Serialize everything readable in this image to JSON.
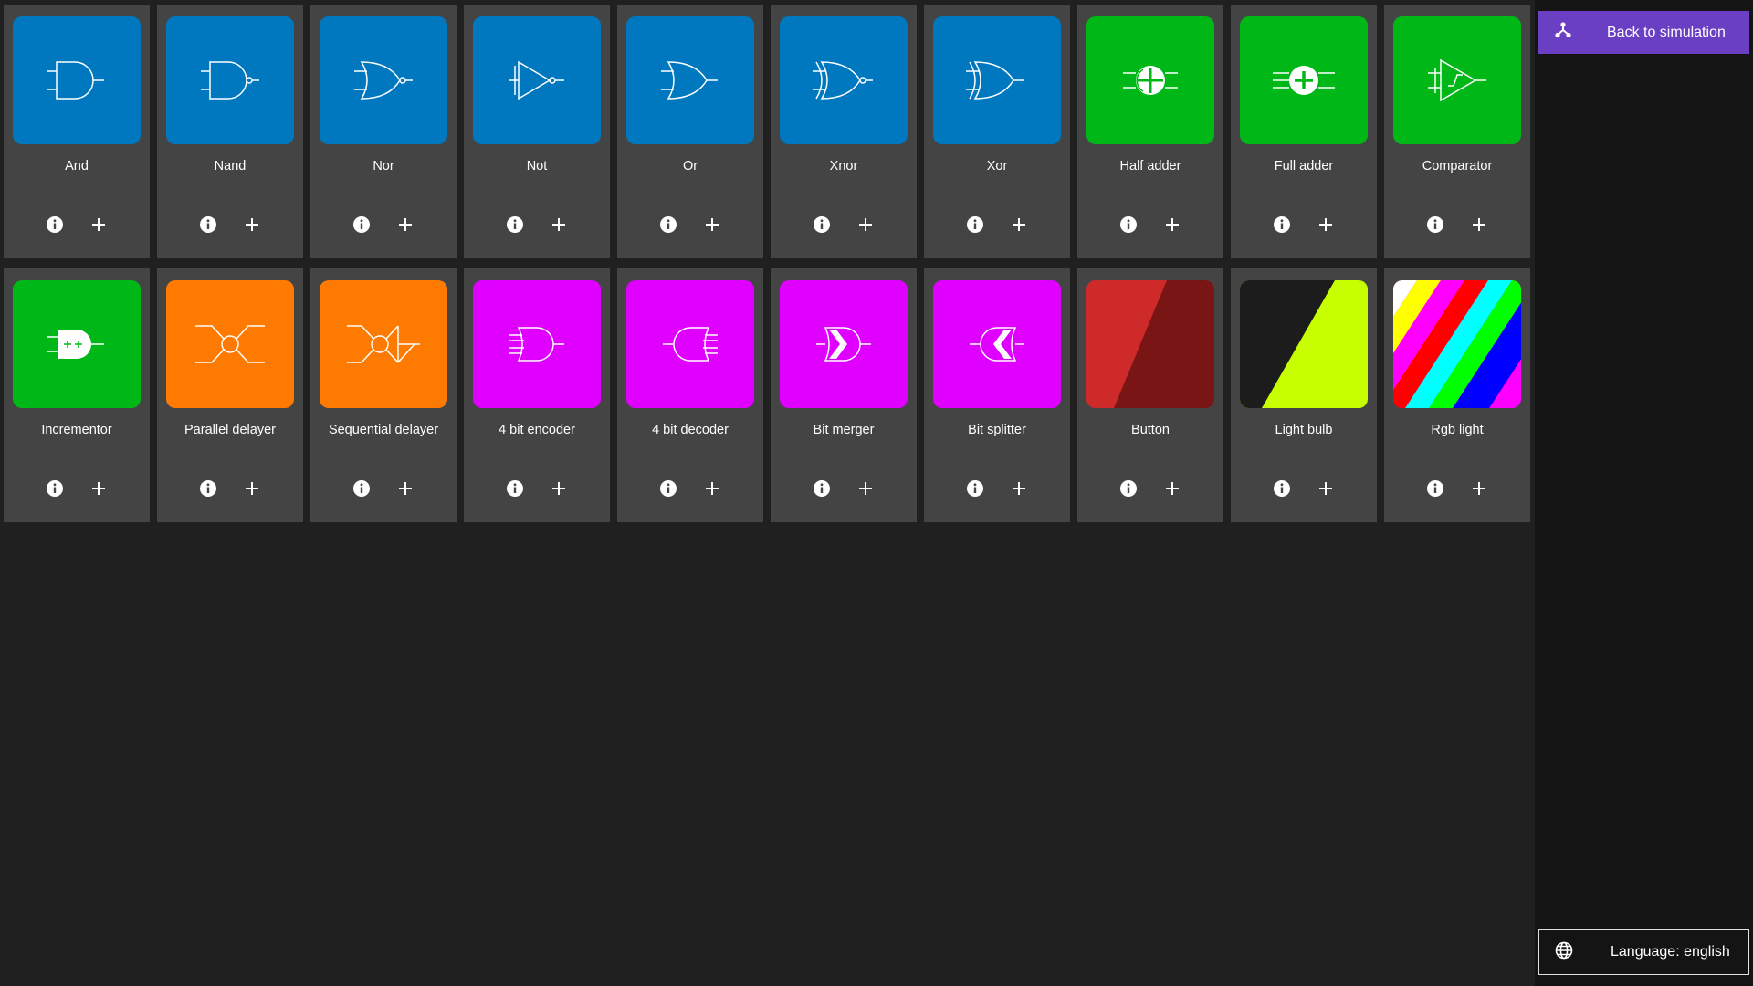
{
  "colors": {
    "page_background": "#202020",
    "card_background": "#444444",
    "sidebar_background": "#141414",
    "accent_purple": "#6a3fc4",
    "gate_blue": "#0078c0",
    "adder_green": "#00b718",
    "delayer_orange": "#ff7a00",
    "wiring_magenta": "#e000ff"
  },
  "components": [
    {
      "name": "And",
      "icon": "and-gate-icon",
      "color": "#0078c0"
    },
    {
      "name": "Nand",
      "icon": "nand-gate-icon",
      "color": "#0078c0"
    },
    {
      "name": "Nor",
      "icon": "nor-gate-icon",
      "color": "#0078c0"
    },
    {
      "name": "Not",
      "icon": "not-gate-icon",
      "color": "#0078c0"
    },
    {
      "name": "Or",
      "icon": "or-gate-icon",
      "color": "#0078c0"
    },
    {
      "name": "Xnor",
      "icon": "xnor-gate-icon",
      "color": "#0078c0"
    },
    {
      "name": "Xor",
      "icon": "xor-gate-icon",
      "color": "#0078c0"
    },
    {
      "name": "Half adder",
      "icon": "half-adder-icon",
      "color": "#00b718"
    },
    {
      "name": "Full adder",
      "icon": "full-adder-icon",
      "color": "#00b718"
    },
    {
      "name": "Comparator",
      "icon": "comparator-icon",
      "color": "#00b718"
    },
    {
      "name": "Incrementor",
      "icon": "incrementor-icon",
      "color": "#00b718"
    },
    {
      "name": "Parallel delayer",
      "icon": "parallel-delayer-icon",
      "color": "#ff7a00"
    },
    {
      "name": "Sequential delayer",
      "icon": "sequential-delayer-icon",
      "color": "#ff7a00"
    },
    {
      "name": "4 bit encoder",
      "icon": "encoder-icon",
      "color": "#e000ff"
    },
    {
      "name": "4 bit decoder",
      "icon": "decoder-icon",
      "color": "#e000ff"
    },
    {
      "name": "Bit merger",
      "icon": "bit-merger-icon",
      "color": "#e000ff"
    },
    {
      "name": "Bit splitter",
      "icon": "bit-splitter-icon",
      "color": "#e000ff"
    },
    {
      "name": "Button",
      "icon": "button-preview-icon",
      "color": "#cf2a2a"
    },
    {
      "name": "Light bulb",
      "icon": "light-bulb-preview-icon",
      "color": "#c8ff00"
    },
    {
      "name": "Rgb light",
      "icon": "rgb-light-preview-icon",
      "color": "#ff00ff"
    }
  ],
  "sidebar": {
    "back_label": "Back to simulation",
    "back_icon": "graph-icon",
    "language_label": "Language: english",
    "language_icon": "globe-icon"
  }
}
